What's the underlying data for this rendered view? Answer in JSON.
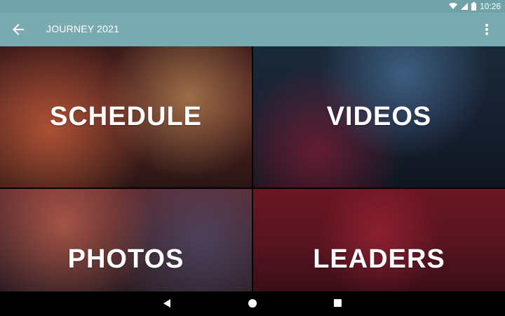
{
  "status_bar": {
    "time": "10:26",
    "icons": [
      "wifi-icon",
      "signal-icon",
      "battery-icon"
    ]
  },
  "app_bar": {
    "title": "JOURNEY 2021",
    "back_icon": "arrow-left-icon",
    "menu_icon": "more-vertical-icon",
    "background": "#79abb0"
  },
  "tiles": [
    {
      "label": "SCHEDULE"
    },
    {
      "label": "VIDEOS"
    },
    {
      "label": "PHOTOS"
    },
    {
      "label": "LEADERS"
    }
  ],
  "nav_bar": {
    "icons": [
      "nav-back-icon",
      "nav-home-icon",
      "nav-recents-icon"
    ]
  }
}
